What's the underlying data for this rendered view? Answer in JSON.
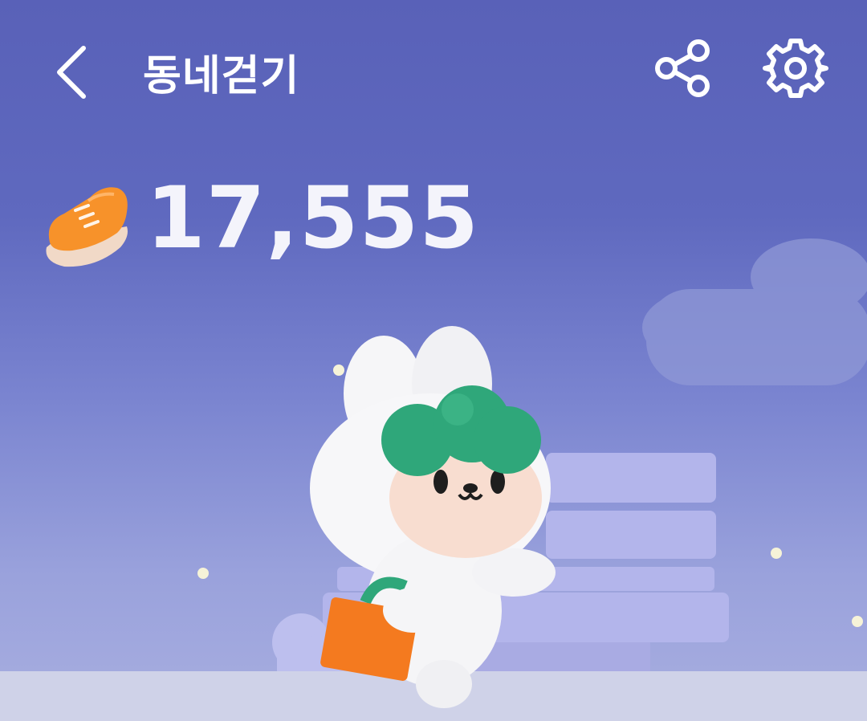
{
  "header": {
    "title": "동네걷기",
    "back_icon": "chevron-left-icon",
    "share_icon": "share-icon",
    "settings_icon": "gear-icon"
  },
  "steps": {
    "icon": "shoe-icon",
    "count": "17,555"
  },
  "colors": {
    "background_top": "#5961b8",
    "background_bottom": "#a8aee0",
    "title_text": "#ffffff",
    "shoe": "#f7922a",
    "character_leaf": "#2fa77a",
    "bag": "#f47a1f"
  }
}
